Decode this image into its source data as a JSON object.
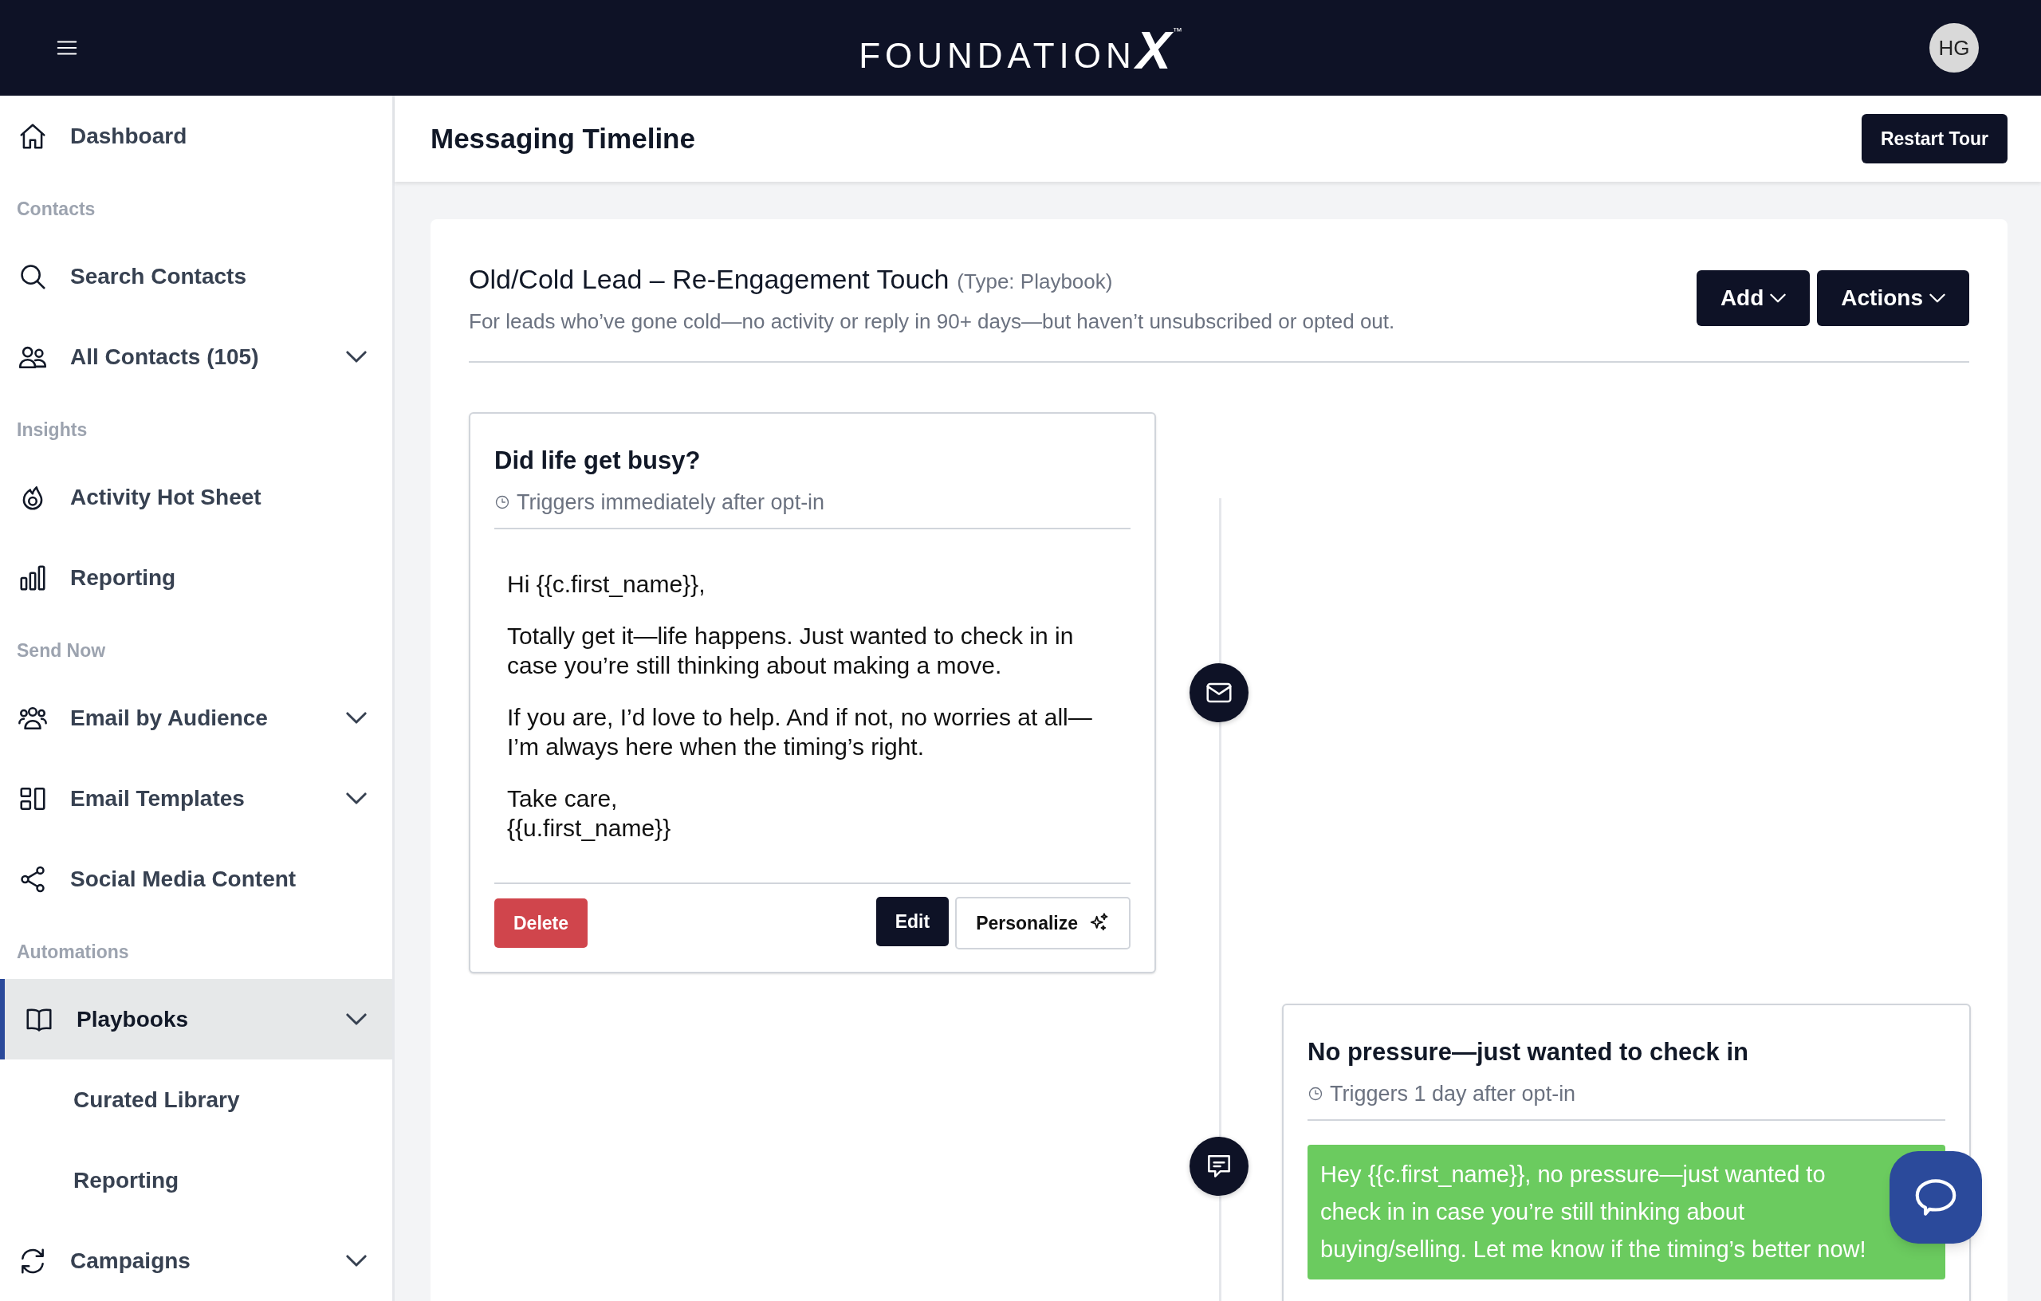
{
  "header": {
    "logo": {
      "word": "FOUNDATION",
      "mark": "X",
      "tm": "™"
    },
    "avatar": "HG"
  },
  "sidebar": {
    "items": [
      {
        "kind": "item",
        "label": "Dashboard",
        "expandable": false,
        "selected": false
      },
      {
        "kind": "section",
        "label": "Contacts"
      },
      {
        "kind": "item",
        "label": "Search Contacts",
        "expandable": false,
        "selected": false
      },
      {
        "kind": "item",
        "label": "All Contacts (105)",
        "expandable": true,
        "selected": false
      },
      {
        "kind": "section",
        "label": "Insights"
      },
      {
        "kind": "item",
        "label": "Activity Hot Sheet",
        "expandable": false,
        "selected": false
      },
      {
        "kind": "item",
        "label": "Reporting",
        "expandable": false,
        "selected": false
      },
      {
        "kind": "section",
        "label": "Send Now"
      },
      {
        "kind": "item",
        "label": "Email by Audience",
        "expandable": true,
        "selected": false
      },
      {
        "kind": "item",
        "label": "Email Templates",
        "expandable": true,
        "selected": false
      },
      {
        "kind": "item",
        "label": "Social Media Content",
        "expandable": false,
        "selected": false
      },
      {
        "kind": "section",
        "label": "Automations"
      },
      {
        "kind": "item",
        "label": "Playbooks",
        "expandable": true,
        "selected": true
      },
      {
        "kind": "subitem",
        "label": "Curated Library",
        "expandable": false,
        "selected": false
      },
      {
        "kind": "subitem",
        "label": "Reporting",
        "expandable": false,
        "selected": false
      },
      {
        "kind": "item",
        "label": "Campaigns",
        "expandable": true,
        "selected": false
      }
    ]
  },
  "page": {
    "title": "Messaging Timeline",
    "restart_button": "Restart Tour"
  },
  "playbook": {
    "title": "Old/Cold Lead – Re-Engagement Touch",
    "type": "(Type: Playbook)",
    "description": "For leads who’ve gone cold—no activity or reply in 90+ days—but haven’t unsubscribed or opted out.",
    "buttons": [
      "Add",
      "Actions"
    ]
  },
  "steps": [
    {
      "kind": "email",
      "title": "Did life get busy?",
      "trigger": "Triggers immediately after opt-in",
      "paragraphs": [
        "Hi {{c.first_name}},",
        "Totally get it—life happens. Just wanted to check in in case you’re still thinking about making a move.",
        "If you are, I’d love to help. And if not, no worries at all—I’m always here when the timing’s right.",
        "Take care,\n{{u.first_name}}"
      ],
      "delete": "Delete",
      "edit": "Edit",
      "personalize": "Personalize"
    },
    {
      "kind": "sms",
      "title": "No pressure—just wanted to check in",
      "trigger": "Triggers 1 day after opt-in",
      "paragraphs": [
        "Hey {{c.first_name}}, no pressure—just wanted to check in in case you’re still thinking about buying/selling. Let me know if the timing’s better now!"
      ]
    }
  ]
}
